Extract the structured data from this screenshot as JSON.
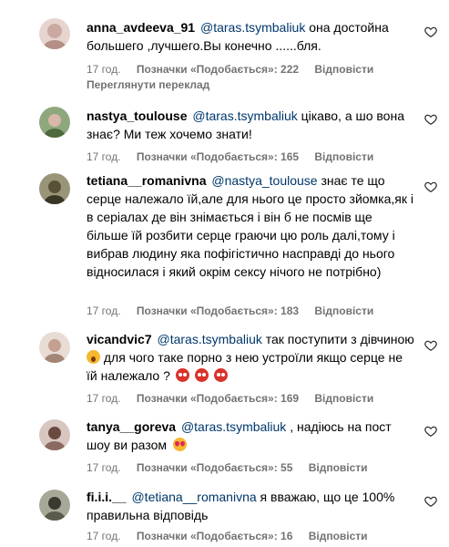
{
  "comments": [
    {
      "username": "anna_avdeeva_91",
      "mention": "@taras.tsymbaliuk",
      "text": " она достойна большего ,лучшего.Вы конечно ......бля.",
      "time": "17 год.",
      "likes": "Позначки «Подобається»: 222",
      "reply": "Відповісти",
      "translate": "Переглянути переклад",
      "avatar_color": "#c9a9a0"
    },
    {
      "username": "nastya_toulouse",
      "mention": "@taras.tsymbaliuk",
      "text": " цікаво, а шо вона знає? Ми теж хочемо знати!",
      "time": "17 год.",
      "likes": "Позначки «Подобається»: 165",
      "reply": "Відповісти",
      "avatar_color": "#6b8a5a"
    },
    {
      "username": "tetiana__romanivna",
      "mention": "@nastya_toulouse",
      "text": " знає те що серце належало їй,але для нього це просто зйомка,як і в серіалах де він знімається і він б не посмів ще більше їй розбити серце граючи цю роль далі,тому і вибрав людину яка пофігістично насправді до нього відносилася і який окрім сексу нічого не потрібно)",
      "time": "17 год.",
      "likes": "Позначки «Подобається»: 183",
      "reply": "Відповісти",
      "avatar_color": "#6e6a4e"
    },
    {
      "username": "vicandvic7",
      "mention": "@taras.tsymbaliuk",
      "text_a": " так поступити з дівчиною ",
      "text_b": " для чого таке порно з нею устроїли якщо серце не їй належало ?",
      "time": "17 год.",
      "likes": "Позначки «Подобається»: 169",
      "reply": "Відповісти",
      "avatar_color": "#b89a8a"
    },
    {
      "username": "tanya__goreva",
      "mention": "@taras.tsymbaliuk",
      "text": " , надіюсь на пост шоу ви разом ",
      "time": "17 год.",
      "likes": "Позначки «Подобається»: 55",
      "reply": "Відповісти",
      "avatar_color": "#8f6f68"
    },
    {
      "username": "fi.i.i.__",
      "mention": "@tetiana__romanivna",
      "text": " я вважаю, що це 100% правильна відповідь",
      "time": "17 год.",
      "likes": "Позначки «Подобається»: 16",
      "reply": "Відповісти",
      "avatar_color": "#7a7a6a"
    }
  ],
  "icons": {
    "like": "heart-outline-icon"
  }
}
